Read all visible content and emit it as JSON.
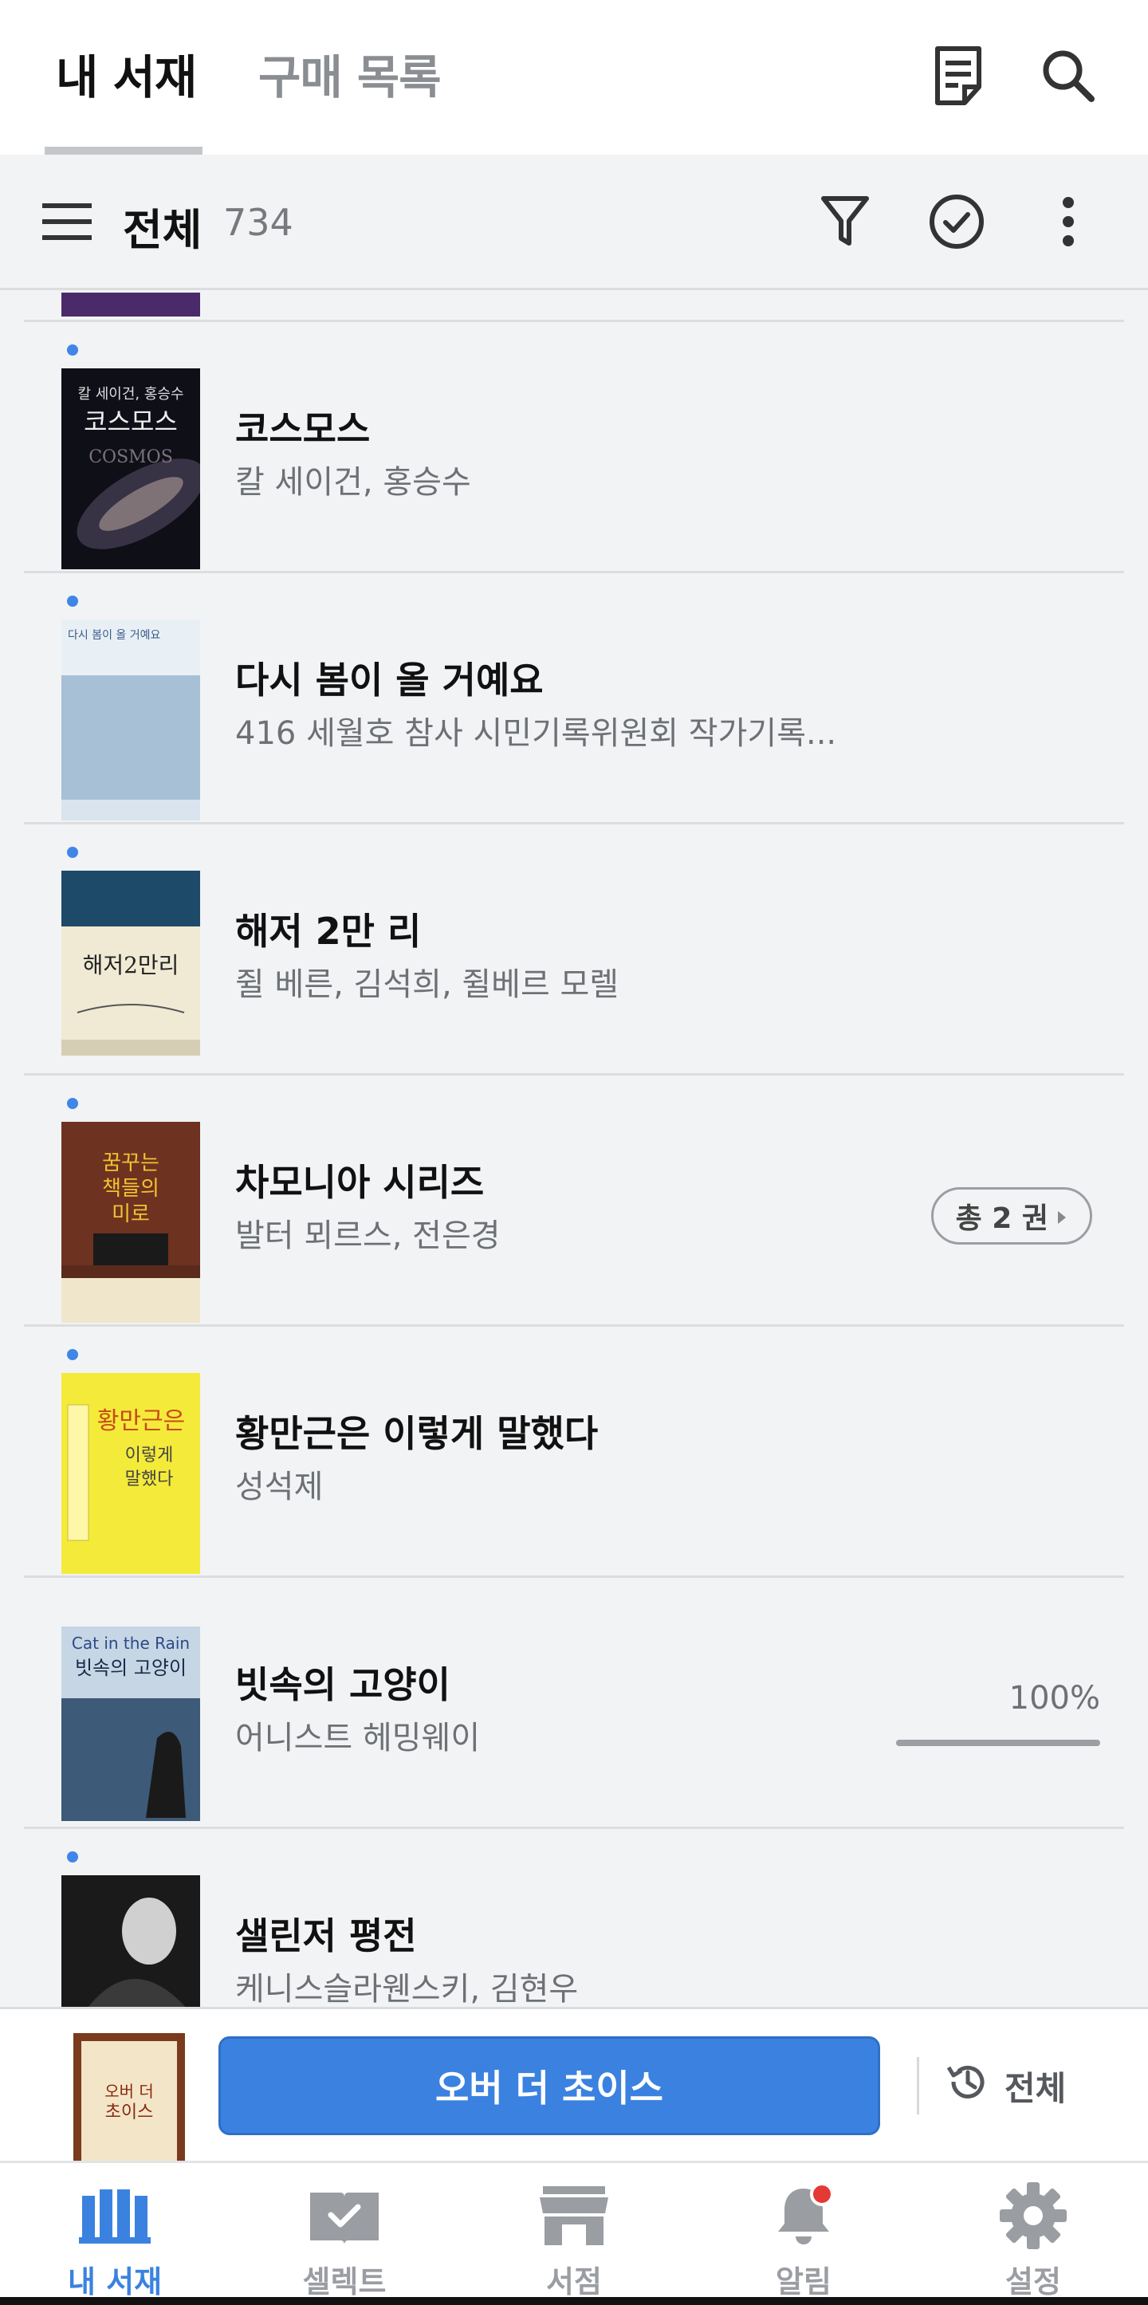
{
  "header": {
    "tabs": [
      {
        "label": "내 서재",
        "active": true
      },
      {
        "label": "구매 목록",
        "active": false
      }
    ],
    "icons": [
      "notes-icon",
      "search-icon"
    ]
  },
  "subheader": {
    "label": "전체",
    "count": "734",
    "icons": [
      "menu-icon",
      "filter-icon",
      "check-circle-icon",
      "more-vert-icon"
    ]
  },
  "books": [
    {
      "title": "코스모스",
      "author": "칼 세이건, 홍승수",
      "unread": true,
      "cover_color": "#14141c",
      "cover_text": "코스모스",
      "cover_sub": "COSMOS"
    },
    {
      "title": "다시 봄이 올 거예요",
      "author": "416 세월호 참사 시민기록위원회 작가기록...",
      "unread": true,
      "cover_color": "#a9c2d8",
      "cover_text": "다시 봄이 올 거예요"
    },
    {
      "title": "해저 2만 리",
      "author": "쥘 베른, 김석희, 쥘베르 모렐",
      "unread": true,
      "cover_color": "#f1ecd8",
      "cover_text": "해저2만리"
    },
    {
      "title": "차모니아 시리즈",
      "author": "발터 뫼르스, 전은경",
      "unread": true,
      "badge": "총 2 권",
      "cover_color": "#5a2a1c",
      "cover_text": "꿈꾸는 책들의 미로"
    },
    {
      "title": "황만근은 이렇게 말했다",
      "author": "성석제",
      "unread": true,
      "cover_color": "#f2e63a",
      "cover_text": "황만근은 이렇게 말했다"
    },
    {
      "title": "빗속의 고양이",
      "author": "어니스트 헤밍웨이",
      "unread": false,
      "progress_label": "100%",
      "progress": 1.0,
      "cover_color": "#3d5a78",
      "cover_text": "빗속의 고양이",
      "cover_sub": "Cat in the Rain"
    },
    {
      "title": "샐린저 평전",
      "author": "케니스슬라웬스키, 김현우",
      "unread": true,
      "cover_color": "#1c1c1c"
    }
  ],
  "now_reading": {
    "button_label": "오버 더 초이스",
    "all_label": "전체",
    "cover_color": "#7a3a1e",
    "cover_text": "오버 더 초이스"
  },
  "bottom_nav": [
    {
      "label": "내 서재",
      "icon": "library-icon",
      "active": true
    },
    {
      "label": "셀렉트",
      "icon": "select-book-icon",
      "active": false
    },
    {
      "label": "서점",
      "icon": "store-icon",
      "active": false
    },
    {
      "label": "알림",
      "icon": "bell-icon",
      "active": false,
      "badge": true
    },
    {
      "label": "설정",
      "icon": "gear-icon",
      "active": false
    }
  ],
  "colors": {
    "accent": "#3b82e0",
    "unread_dot": "#3f86e8",
    "notification": "#e53935"
  }
}
